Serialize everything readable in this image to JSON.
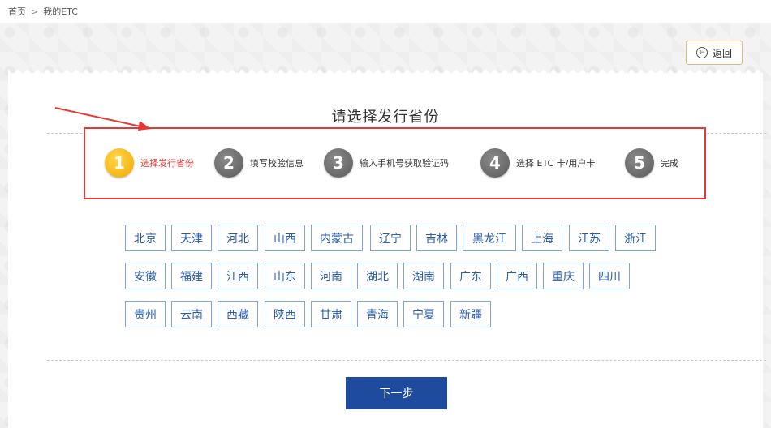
{
  "breadcrumb": {
    "home": "首页",
    "separator": ">",
    "current": "我的ETC"
  },
  "back_button": {
    "label": "返回"
  },
  "title": "请选择发行省份",
  "steps": [
    {
      "num": "1",
      "label": "选择发行省份",
      "active": true
    },
    {
      "num": "2",
      "label": "填写校验信息",
      "active": false
    },
    {
      "num": "3",
      "label": "输入手机号获取验证码",
      "active": false
    },
    {
      "num": "4",
      "label": "选择 ETC 卡/用户卡",
      "active": false
    },
    {
      "num": "5",
      "label": "完成",
      "active": false
    }
  ],
  "provinces": [
    [
      "北京",
      "天津",
      "河北",
      "山西",
      "内蒙古",
      "辽宁",
      "吉林",
      "黑龙江",
      "上海",
      "江苏",
      "浙江"
    ],
    [
      "安徽",
      "福建",
      "江西",
      "山东",
      "河南",
      "湖北",
      "湖南",
      "广东",
      "广西",
      "重庆",
      "四川"
    ],
    [
      "贵州",
      "云南",
      "西藏",
      "陕西",
      "甘肃",
      "青海",
      "宁夏",
      "新疆"
    ]
  ],
  "next_button": {
    "label": "下一步"
  },
  "colors": {
    "accent_red": "#e53935",
    "primary_blue": "#1f4b9f",
    "province_border": "#7fa6d9",
    "active_step": "#f2a900"
  }
}
